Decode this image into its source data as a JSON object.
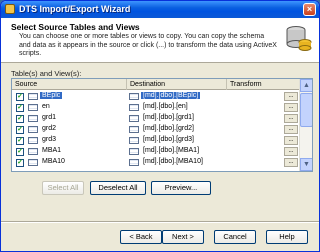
{
  "window": {
    "title": "DTS Import/Export Wizard",
    "close_glyph": "×"
  },
  "header": {
    "title": "Select Source Tables and Views",
    "description": "You can choose one or more tables or views to copy. You can copy the schema and data as it appears in the source or click (...) to transform the data using ActiveX scripts.",
    "icon": "database-icon"
  },
  "grid": {
    "group_label": "Table(s) and View(s):",
    "columns": [
      "Source",
      "Destination",
      "Transform"
    ],
    "rows": [
      {
        "checked": true,
        "source": "BEplc",
        "destination": "[md].[dbo].[BEplc]",
        "transform": "...",
        "selected": true
      },
      {
        "checked": true,
        "source": "en",
        "destination": "[md].[dbo].[en]",
        "transform": "..."
      },
      {
        "checked": true,
        "source": "grd1",
        "destination": "[md].[dbo].[grd1]",
        "transform": "..."
      },
      {
        "checked": true,
        "source": "grd2",
        "destination": "[md].[dbo].[grd2]",
        "transform": "..."
      },
      {
        "checked": true,
        "source": "grd3",
        "destination": "[md].[dbo].[grd3]",
        "transform": "..."
      },
      {
        "checked": true,
        "source": "MBA1",
        "destination": "[md].[dbo].[MBA1]",
        "transform": "..."
      },
      {
        "checked": true,
        "source": "MBA10",
        "destination": "[md].[dbo].[MBA10]",
        "transform": "..."
      }
    ],
    "check_glyph": "✓",
    "scroll_up_glyph": "▲",
    "scroll_down_glyph": "▼"
  },
  "buttons": {
    "select_all": "Select All",
    "deselect_all": "Deselect All",
    "preview": "Preview...",
    "back": "< Back",
    "next": "Next >",
    "cancel": "Cancel",
    "help": "Help"
  }
}
